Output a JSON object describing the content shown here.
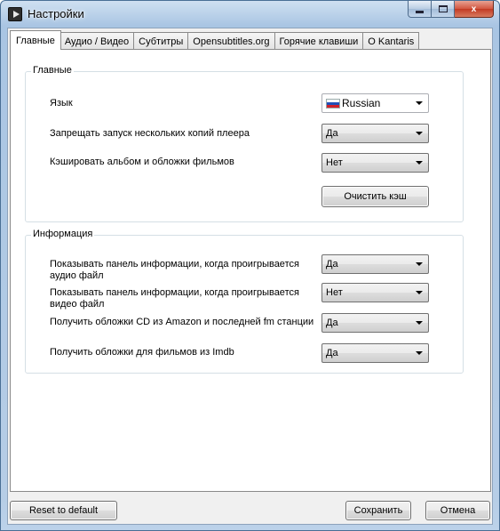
{
  "window": {
    "title": "Настройки",
    "close_glyph": "x"
  },
  "tabs": [
    {
      "label": "Главные",
      "active": true
    },
    {
      "label": "Аудио / Видео"
    },
    {
      "label": "Субтитры"
    },
    {
      "label": "Opensubtitles.org"
    },
    {
      "label": "Горячие клавиши"
    },
    {
      "label": "О Kantaris"
    }
  ],
  "general": {
    "title": "Главные",
    "language": {
      "label": "Язык",
      "value": "Russian",
      "icon": "russia-flag-icon"
    },
    "single_instance": {
      "label": "Запрещать запуск нескольких копий плеера",
      "value": "Да"
    },
    "cache_covers": {
      "label": "Кэшировать альбом и обложки фильмов",
      "value": "Нет"
    },
    "clear_cache_label": "Очистить кэш"
  },
  "info": {
    "title": "Информация",
    "audio_panel": {
      "label_line1": "Показывать панель информации, когда проигрывается",
      "label_line2": "аудио файл",
      "value": "Да"
    },
    "video_panel": {
      "label_line1": "Показывать панель информации, когда проигрывается",
      "label_line2": "видео файл",
      "value": "Нет"
    },
    "cd_covers": {
      "label": "Получить обложки CD из Amazon и последней fm станции",
      "value": "Да"
    },
    "imdb_covers": {
      "label": "Получить обложки для фильмов из Imdb",
      "value": "Да"
    }
  },
  "footer": {
    "reset_label": "Reset to default",
    "save_label": "Сохранить",
    "cancel_label": "Отмена"
  },
  "colors": {
    "accent": "#a9c5e3",
    "close_button": "#c23b24"
  }
}
